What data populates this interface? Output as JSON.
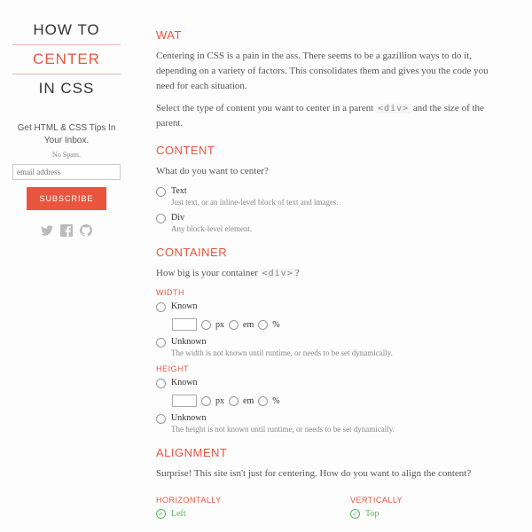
{
  "sidebar": {
    "logo": {
      "line1": "HOW TO",
      "line2": "CENTER",
      "line3": "IN CSS"
    },
    "tips": "Get HTML & CSS Tips In Your Inbox.",
    "nospam": "No Spam.",
    "email_placeholder": "email address",
    "subscribe": "SUBSCRIBE",
    "social": [
      "twitter-icon",
      "facebook-icon",
      "github-icon"
    ]
  },
  "wat": {
    "heading": "WAT",
    "p1": "Centering in CSS is a pain in the ass. There seems to be a gazillion ways to do it, depending on a variety of factors. This consolidates them and gives you the code you need for each situation.",
    "p2a": "Select the type of content you want to center in a parent ",
    "p2code": "<div>",
    "p2b": " and the size of the parent."
  },
  "content": {
    "heading": "CONTENT",
    "question": "What do you want to center?",
    "options": [
      {
        "label": "Text",
        "hint": "Just text, or an inline-level block of text and images."
      },
      {
        "label": "Div",
        "hint": "Any block-level element."
      }
    ]
  },
  "container": {
    "heading": "CONTAINER",
    "qa": "How big is your container ",
    "qcode": "<div>",
    "qb": "?",
    "width_h": "WIDTH",
    "height_h": "HEIGHT",
    "known": "Known",
    "unknown": "Unknown",
    "width_hint": "The width is not known until runtime, or needs to be set dynamically.",
    "height_hint": "The height is not known until runtime, or needs to be set dynamically.",
    "units": [
      "px",
      "em",
      "%"
    ]
  },
  "alignment": {
    "heading": "ALIGNMENT",
    "intro": "Surprise! This site isn't just for centering. How do you want to align the content?",
    "horiz_h": "HORIZONTALLY",
    "vert_h": "VERTICALLY",
    "h_opts": [
      "Left"
    ],
    "v_opts": [
      "Top"
    ]
  }
}
